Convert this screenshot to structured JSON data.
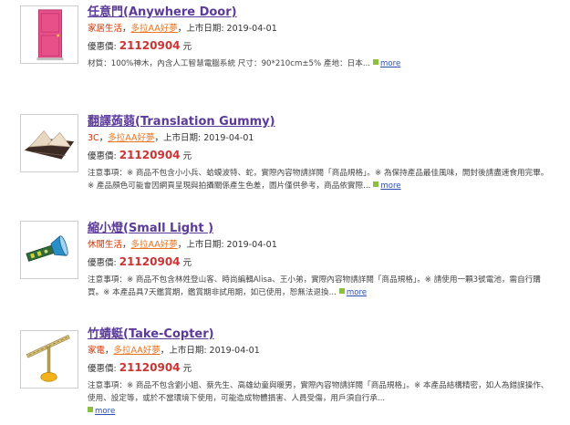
{
  "products": [
    {
      "title": "任意門(Anywhere Door)",
      "category": "家居生活",
      "brand": "多拉AA好夢",
      "release_label": "上市日期:",
      "release_date": "2019-04-01",
      "price_label": "優惠價:",
      "price": "21120904",
      "currency": "元",
      "description": "材質：100%神木，內含人工智慧電腦系統 尺寸：90*210cm±5% 產地：日本...",
      "more": "more",
      "image_icon": "pink-door-icon"
    },
    {
      "title": "翻譯蒟蒻(Translation Gummy)",
      "category": "3C",
      "brand": "多拉AA好夢",
      "release_label": "上市日期:",
      "release_date": "2019-04-01",
      "price_label": "優惠價:",
      "price": "21120904",
      "currency": "元",
      "description": "注意事項：※ 商品不包含小小兵、蛤蟆波特、蛇，實際內容物請詳閱「商品規格」。※ 為保持產品最佳風味，開封後請盡速食用完畢。※ 產品顏色可能會因網頁呈現與拍攝關係產生色差，圖片僅供參考，商品依實際...",
      "more": "more",
      "image_icon": "gummy-jelly-icon"
    },
    {
      "title": "縮小燈(Small Light )",
      "category": "休閒生活",
      "brand": "多拉AA好夢",
      "release_label": "上市日期:",
      "release_date": "2019-04-01",
      "price_label": "優惠價:",
      "price": "21120904",
      "currency": "元",
      "description": "注意事項：※ 商品不包含林姓登山客、時尚編輯Alisa、王小弟，實際內容物請詳閱「商品規格」。※ 請使用一顆3號電池，需自行購買。※ 本產品具7天鑑賞期，鑑賞期非試用期，如已使用，恕無法退換...",
      "more": "more",
      "image_icon": "flashlight-icon"
    },
    {
      "title": "竹蜻蜓(Take-Copter)",
      "category": "家電",
      "brand": "多拉AA好夢",
      "release_label": "上市日期:",
      "release_date": "2019-04-01",
      "price_label": "優惠價:",
      "price": "21120904",
      "currency": "元",
      "description": "注意事項：※ 商品不包含劉小姐、蔡先生、高雄幼童與暖男，實際內容物請詳閱「商品規格」。※ 本產品結構精密，如人為錯誤操作、使用、設定等，或於不當環境下使用，可能造成物體損害、人員受傷，用戶須自行承...",
      "more": "more",
      "image_icon": "bamboo-copter-icon"
    }
  ]
}
